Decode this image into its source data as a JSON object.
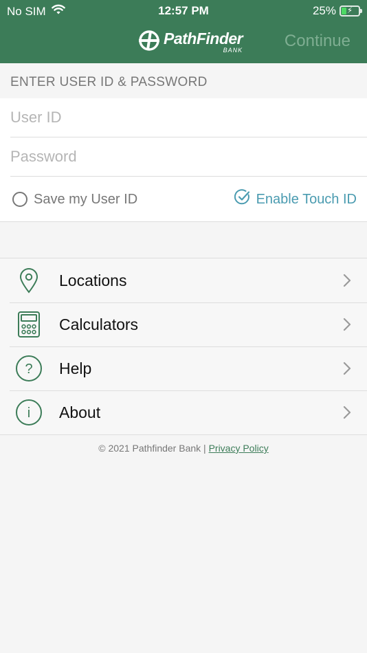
{
  "status_bar": {
    "carrier": "No SIM",
    "time": "12:57 PM",
    "battery_percent": "25%",
    "battery_level": 0.25
  },
  "nav": {
    "logo_main": "PathFinder",
    "logo_sub": "BANK",
    "continue_label": "Continue"
  },
  "login": {
    "section_label": "ENTER USER ID & PASSWORD",
    "userid_placeholder": "User ID",
    "password_placeholder": "Password",
    "save_userid_label": "Save my User ID",
    "touch_id_label": "Enable Touch ID"
  },
  "menu": {
    "items": [
      {
        "label": "Locations",
        "icon": "location-pin-icon"
      },
      {
        "label": "Calculators",
        "icon": "calculator-icon"
      },
      {
        "label": "Help",
        "icon": "question-circle-icon"
      },
      {
        "label": "About",
        "icon": "info-circle-icon"
      }
    ]
  },
  "footer": {
    "copyright": "© 2021 Pathfinder Bank |",
    "privacy_label": "Privacy Policy"
  },
  "colors": {
    "brand_green": "#3c7c58",
    "continue_disabled": "#7fae92",
    "touch_id_accent": "#4a9bb0",
    "battery_green": "#4cd964",
    "background": "#f5f5f5"
  }
}
